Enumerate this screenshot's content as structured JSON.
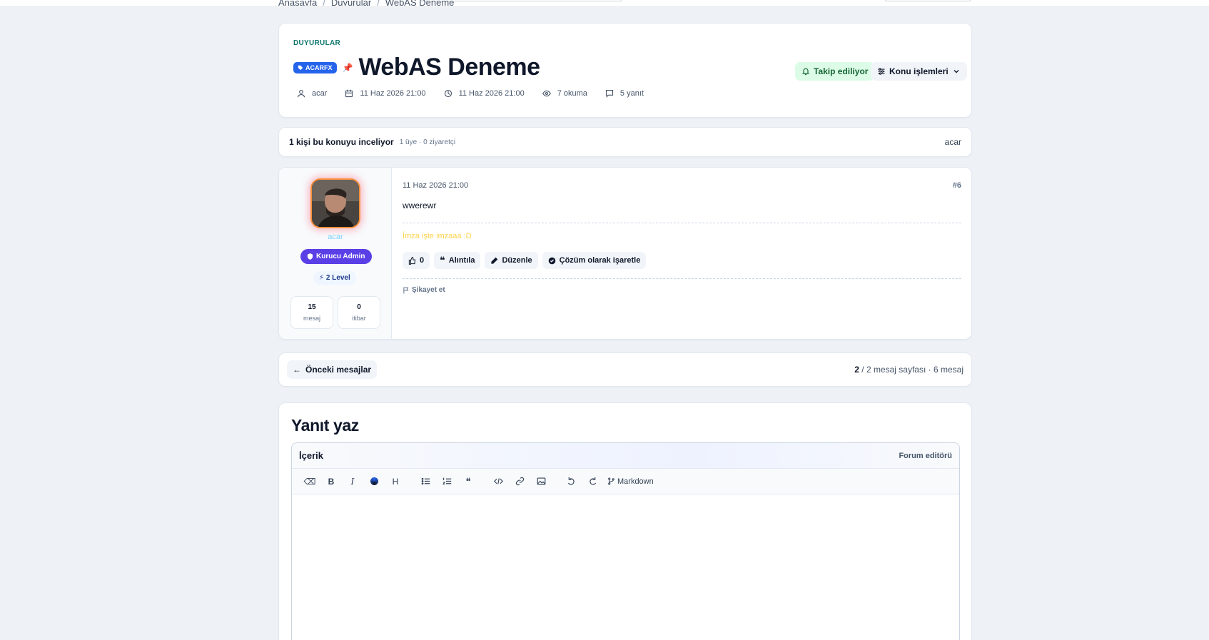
{
  "breadcrumb": [
    "Anasayfa",
    "Duyurular",
    "WebAS Deneme"
  ],
  "thread": {
    "category": "DUYURULAR",
    "prefix": "ACARFX",
    "title": "WebAS Deneme",
    "meta": {
      "author": "acar",
      "created": "11 Haz 2026 21:00",
      "updated": "11 Haz 2026 21:00",
      "views": "7 okuma",
      "replies": "5 yanıt"
    },
    "follow_label": "Takip ediliyor",
    "actions_label": "Konu işlemleri"
  },
  "viewers": {
    "main": "1 kişi bu konuyu inceliyor",
    "sub": "1 üye · 0 ziyaretçi",
    "names": "acar"
  },
  "post": {
    "user": {
      "name": "acar",
      "rank": "Kurucu Admin",
      "level": "2 Level",
      "messages": "15",
      "messages_label": "mesaj",
      "reputation": "0",
      "reputation_label": "itibar"
    },
    "date": "11 Haz 2026 21:00",
    "number": "#6",
    "body": "wwerewr",
    "signature": "İmza işte imzaaa :D",
    "like_count": "0",
    "quote_label": "Alıntıla",
    "edit_label": "Düzenle",
    "solution_label": "Çözüm olarak işaretle",
    "report_label": "Şikayet et"
  },
  "pagination": {
    "prev_label": "Önceki mesajlar",
    "current": "2",
    "rest": " / 2 mesaj sayfası · 6 mesaj"
  },
  "reply": {
    "heading": "Yanıt yaz",
    "editor_label": "İçerik",
    "editor_brand": "Forum editörü",
    "markdown_label": "Markdown"
  },
  "colors": {
    "accent": "#2563eb",
    "rank": "#5b3fe6",
    "follow_bg": "#dcfce7",
    "signature": "#fcd34d"
  }
}
